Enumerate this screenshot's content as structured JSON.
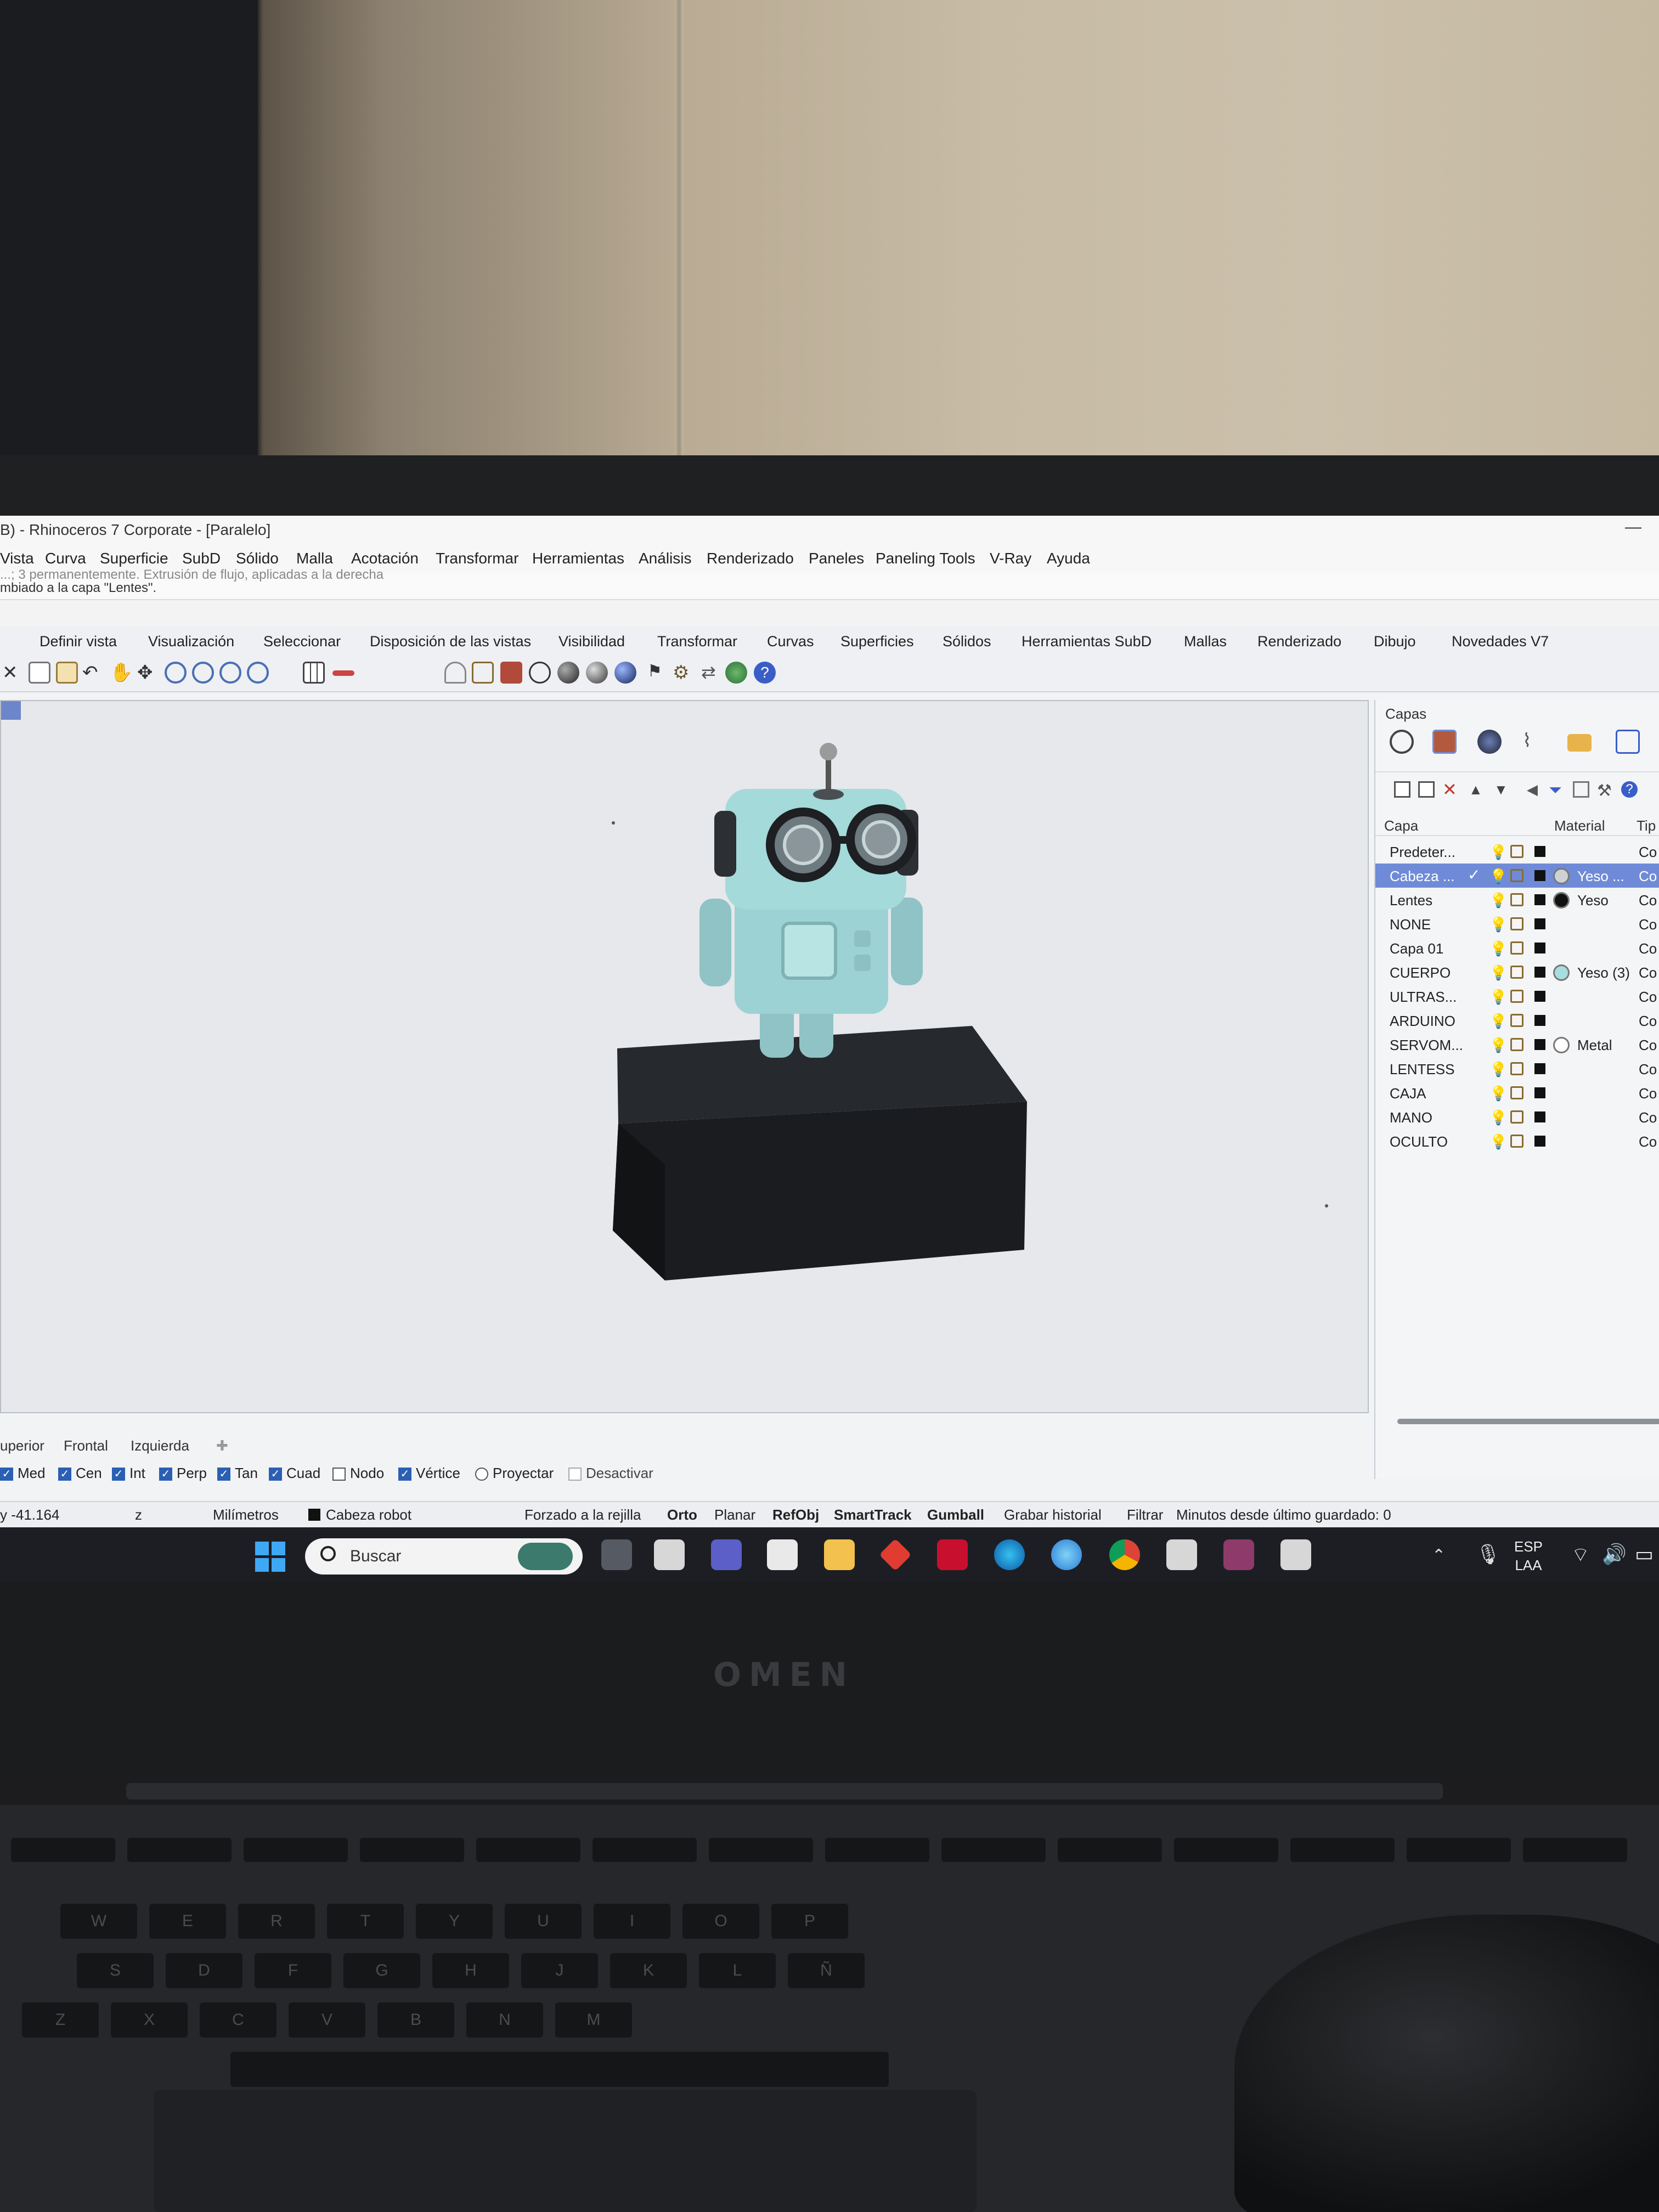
{
  "window": {
    "title": "B) - Rhinoceros 7 Corporate - [Paralelo]"
  },
  "menu": [
    "Vista",
    "Curva",
    "Superficie",
    "SubD",
    "Sólido",
    "Malla",
    "Acotación",
    "Transformar",
    "Herramientas",
    "Análisis",
    "Renderizado",
    "Paneles",
    "Paneling Tools",
    "V-Ray",
    "Ayuda"
  ],
  "command_history": {
    "line1": "...; 3 permanentemente. Extrusión de flujo, aplicadas a la derecha",
    "line2": "mbiado a la capa \"Lentes\"."
  },
  "toolbar_tabs": [
    "Definir vista",
    "Visualización",
    "Seleccionar",
    "Disposición de las vistas",
    "Visibilidad",
    "Transformar",
    "Curvas",
    "Superficies",
    "Sólidos",
    "Herramientas SubD",
    "Mallas",
    "Renderizado",
    "Dibujo",
    "Novedades V7"
  ],
  "layers_panel": {
    "title": "Capas",
    "columns": {
      "layer": "Capa",
      "material": "Material",
      "type": "Tip"
    },
    "rows": [
      {
        "name": "Predeter...",
        "material": "",
        "tip": "Co",
        "selected": false
      },
      {
        "name": "Cabeza ...",
        "material": "Yeso ...",
        "tip": "Co",
        "selected": true,
        "current": true
      },
      {
        "name": "Lentes",
        "material": "Yeso",
        "tip": "Co",
        "selected": false
      },
      {
        "name": "NONE",
        "material": "",
        "tip": "Co",
        "selected": false
      },
      {
        "name": "Capa 01",
        "material": "",
        "tip": "Co",
        "selected": false
      },
      {
        "name": "CUERPO",
        "material": "Yeso (3)",
        "tip": "Co",
        "selected": false
      },
      {
        "name": "ULTRAS...",
        "material": "",
        "tip": "Co",
        "selected": false
      },
      {
        "name": "ARDUINO",
        "material": "",
        "tip": "Co",
        "selected": false
      },
      {
        "name": "SERVOM...",
        "material": "Metal",
        "tip": "Co",
        "selected": false
      },
      {
        "name": "LENTESS",
        "material": "",
        "tip": "Co",
        "selected": false
      },
      {
        "name": "CAJA",
        "material": "",
        "tip": "Co",
        "selected": false
      },
      {
        "name": "MANO",
        "material": "",
        "tip": "Co",
        "selected": false
      },
      {
        "name": "OCULTO",
        "material": "",
        "tip": "Co",
        "selected": false
      }
    ]
  },
  "viewport_tabs": [
    "uperior",
    "Frontal",
    "Izquierda"
  ],
  "osnaps": [
    {
      "label": "Med",
      "checked": true
    },
    {
      "label": "Cen",
      "checked": true
    },
    {
      "label": "Int",
      "checked": true
    },
    {
      "label": "Perp",
      "checked": true
    },
    {
      "label": "Tan",
      "checked": true
    },
    {
      "label": "Cuad",
      "checked": true
    },
    {
      "label": "Nodo",
      "checked": false
    },
    {
      "label": "Vértice",
      "checked": true
    },
    {
      "label": "Proyectar",
      "checked": false
    },
    {
      "label": "Desactivar",
      "checked": false
    }
  ],
  "statusbar": {
    "y": "y -41.164",
    "z": "z",
    "units": "Milímetros",
    "layer": "Cabeza robot",
    "grid_snap": "Forzado a la rejilla",
    "ortho": "Orto",
    "planar": "Planar",
    "osnap": "RefObj",
    "smarttrack": "SmartTrack",
    "gumball": "Gumball",
    "history": "Grabar historial",
    "filter": "Filtrar",
    "autosave": "Minutos desde último guardado: 0"
  },
  "taskbar": {
    "search_placeholder": "Buscar",
    "lang_line1": "ESP",
    "lang_line2": "LAA"
  },
  "brand": "OMEN",
  "keyboard": {
    "row1": [
      "W",
      "E",
      "R",
      "T",
      "Y",
      "U",
      "I",
      "O",
      "P"
    ],
    "row2": [
      "S",
      "D",
      "F",
      "G",
      "H",
      "J",
      "K",
      "L",
      "Ñ"
    ],
    "row3": [
      "Z",
      "X",
      "C",
      "V",
      "B",
      "N",
      "M"
    ]
  }
}
